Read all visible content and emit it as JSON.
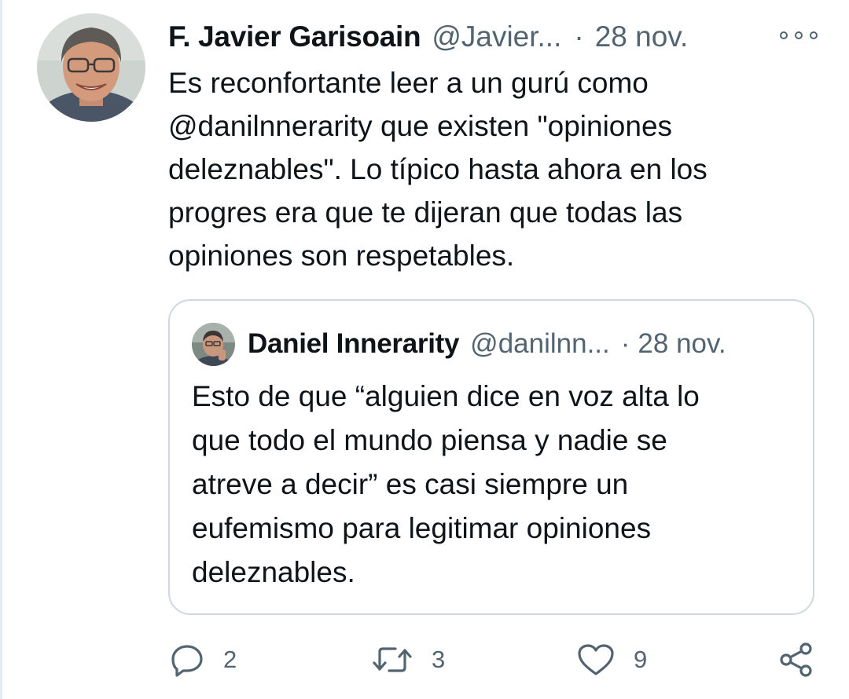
{
  "tweet": {
    "author": {
      "name": "F. Javier Garisoain",
      "handle": "@Javier...",
      "avatar_icon": "user-avatar-photo"
    },
    "separator": "·",
    "date": "28 nov.",
    "more_icon": "more-options-icon",
    "text": "Es reconfortante leer a un gurú como\n@danilnnerarity que existen \"opiniones\ndeleznables\". Lo típico hasta ahora en los\nprogres era que te dijeran que todas las\nopiniones son respetables."
  },
  "quote": {
    "author": {
      "name": "Daniel Innerarity",
      "handle": "@danilnn...",
      "avatar_icon": "user-avatar-photo"
    },
    "separator": "·",
    "date": "28 nov.",
    "text": "Esto de que “alguien dice en voz alta lo\nque todo el mundo piensa y nadie se\natreve a decir” es casi siempre un\neufemismo para legitimar opiniones\ndeleznables."
  },
  "actions": {
    "reply": {
      "icon": "reply-icon",
      "count": "2"
    },
    "retweet": {
      "icon": "retweet-icon",
      "count": "3"
    },
    "like": {
      "icon": "heart-icon",
      "count": "9"
    },
    "share": {
      "icon": "share-icon"
    }
  },
  "colors": {
    "text": "#0f1419",
    "secondary": "#536471",
    "border": "#cfd9de"
  }
}
